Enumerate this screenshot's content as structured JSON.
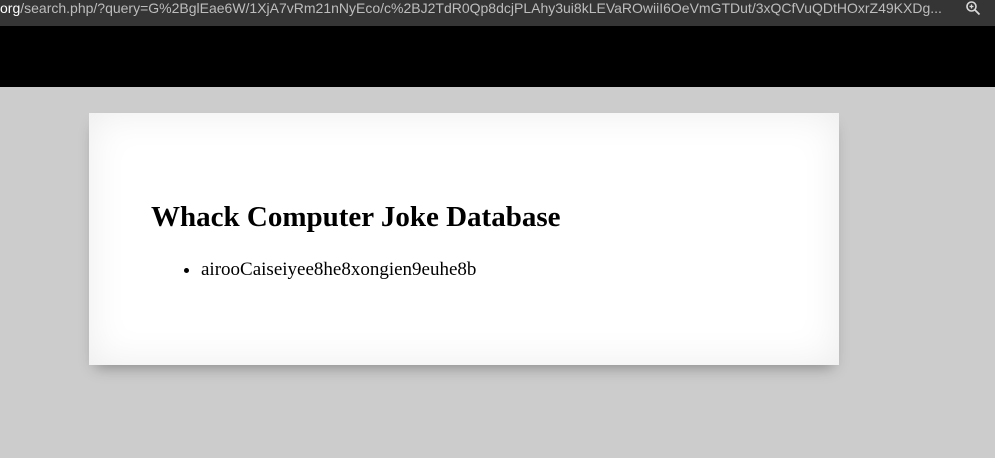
{
  "browser": {
    "url_domain": "org",
    "url_path": "/search.php/?query=G%2BglEae6W/1XjA7vRm21nNyEco/c%2BJ2TdR0Qp8dcjPLAhy3ui8kLEVaROwiiI6OeVmGTDut/3xQCfVuQDtHOxrZ49KXDg...",
    "zoom_icon": "zoom-in-icon"
  },
  "page": {
    "title": "Whack Computer Joke Database",
    "results": [
      "airooCaiseiyee8he8xongien9euhe8b"
    ]
  },
  "colors": {
    "background": "#cccccc",
    "card": "#ffffff",
    "header_band": "#000000",
    "url_bar": "#353535"
  }
}
